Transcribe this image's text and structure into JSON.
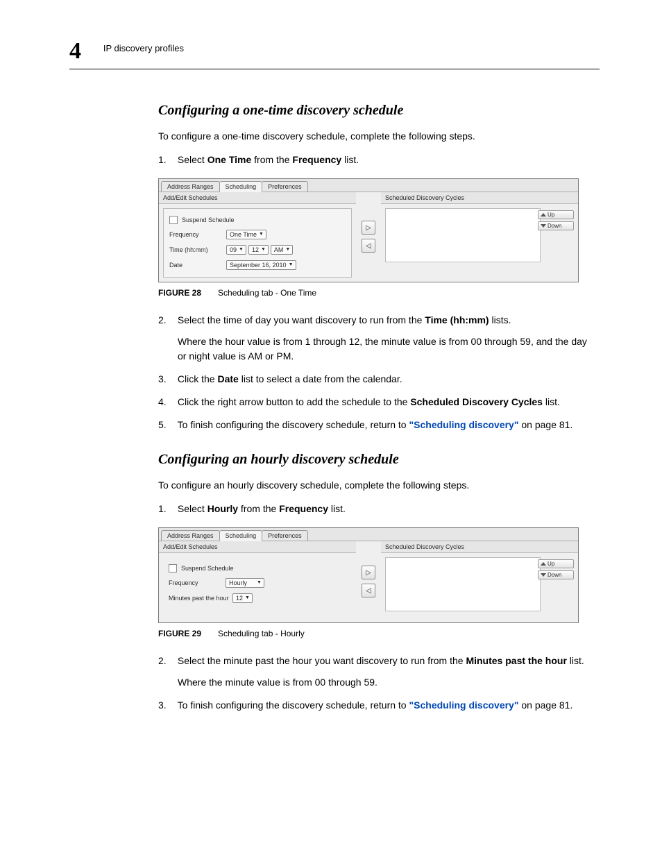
{
  "header": {
    "chapter_number": "4",
    "section_name": "IP discovery profiles"
  },
  "section1": {
    "title": "Configuring a one-time discovery schedule",
    "intro": "To configure a one-time discovery schedule, complete the following steps.",
    "step1_pre": "Select ",
    "step1_bold1": "One Time",
    "step1_mid": " from the ",
    "step1_bold2": "Frequency",
    "step1_post": " list.",
    "fig": {
      "label": "FIGURE 28",
      "title": "Scheduling tab - One Time",
      "tabs": [
        "Address Ranges",
        "Scheduling",
        "Preferences"
      ],
      "left_title": "Add/Edit Schedules",
      "right_title": "Scheduled Discovery Cycles",
      "suspend": "Suspend Schedule",
      "row_freq": "Frequency",
      "row_freq_val": "One Time",
      "row_time": "Time (hh:mm)",
      "row_time_h": "09",
      "row_time_m": "12",
      "row_time_ap": "AM",
      "row_date": "Date",
      "row_date_val": "September 16, 2010",
      "btn_up": "Up",
      "btn_down": "Down"
    },
    "step2_pre": "Select the time of day you want discovery to run from the ",
    "step2_bold": "Time (hh:mm)",
    "step2_post": " lists.",
    "step2_sub": "Where the hour value is from 1 through 12, the minute value is from 00 through 59, and the day or night value is AM or PM.",
    "step3_pre": "Click the ",
    "step3_bold": "Date",
    "step3_post": " list to select a date from the calendar.",
    "step4_pre": "Click the right arrow button to add the schedule to the ",
    "step4_bold": "Scheduled Discovery Cycles",
    "step4_post": " list.",
    "step5_pre": "To finish configuring the discovery schedule, return to ",
    "step5_link": "\"Scheduling discovery\"",
    "step5_post": " on page 81."
  },
  "section2": {
    "title": "Configuring an hourly discovery schedule",
    "intro": "To configure an hourly discovery schedule, complete the following steps.",
    "step1_pre": "Select ",
    "step1_bold1": "Hourly",
    "step1_mid": " from the ",
    "step1_bold2": "Frequency",
    "step1_post": " list.",
    "fig": {
      "label": "FIGURE 29",
      "title": "Scheduling tab - Hourly",
      "tabs": [
        "Address Ranges",
        "Scheduling",
        "Preferences"
      ],
      "left_title": "Add/Edit Schedules",
      "right_title": "Scheduled Discovery Cycles",
      "suspend": "Suspend Schedule",
      "row_freq": "Frequency",
      "row_freq_val": "Hourly",
      "row_min": "Minutes past the hour",
      "row_min_val": "12",
      "btn_up": "Up",
      "btn_down": "Down"
    },
    "step2_pre": "Select the minute past the hour you want discovery to run from the ",
    "step2_bold": "Minutes past the hour",
    "step2_post": " list.",
    "step2_sub": "Where the minute value is from 00 through 59.",
    "step3_pre": "To finish configuring the discovery schedule, return to ",
    "step3_link": "\"Scheduling discovery\"",
    "step3_post": " on page 81."
  }
}
